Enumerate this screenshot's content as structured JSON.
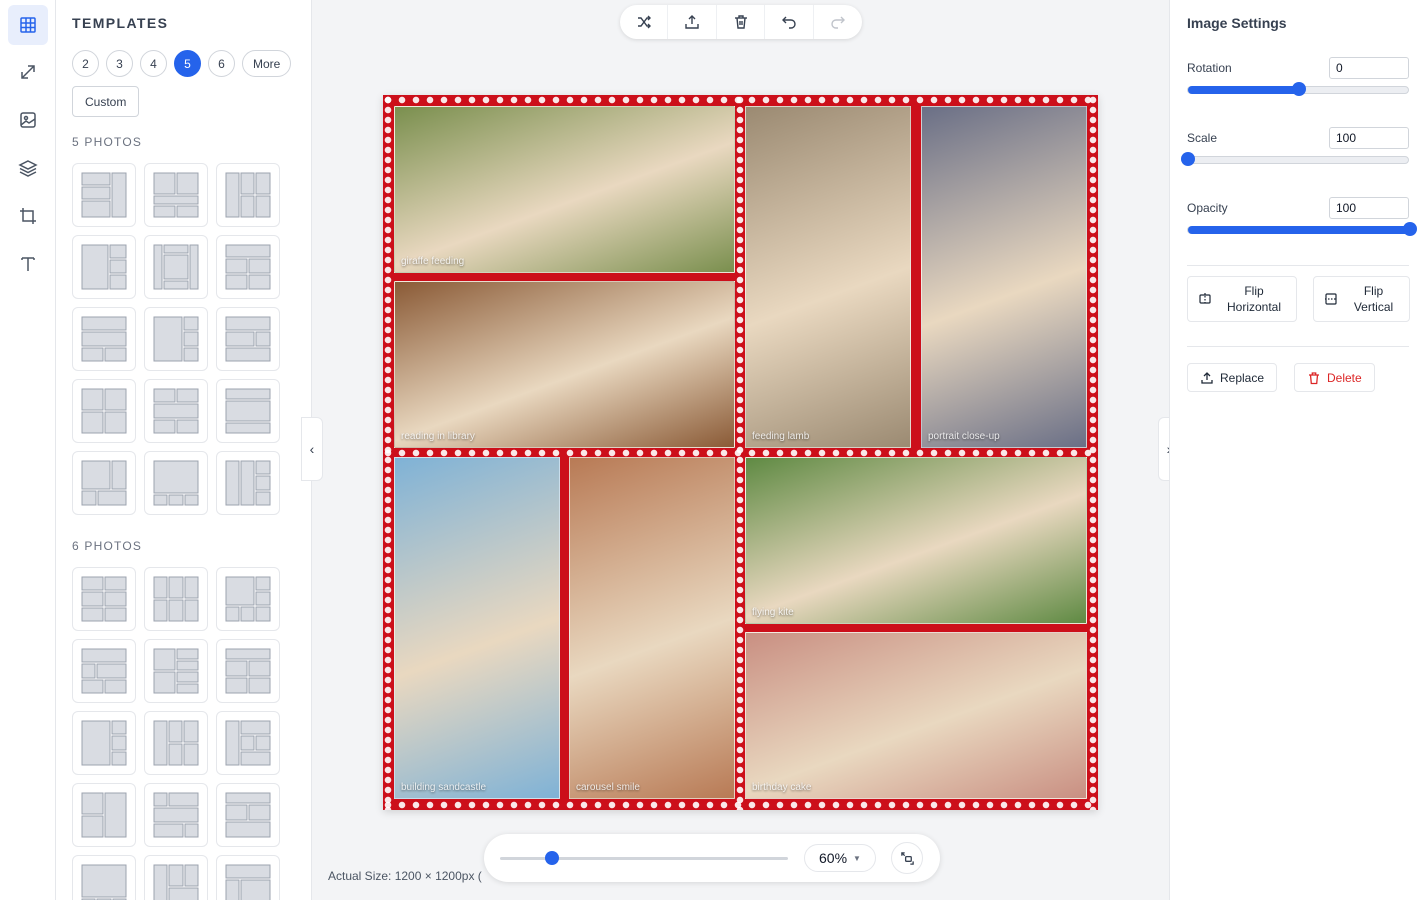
{
  "rail": {
    "items": [
      {
        "icon": "layout-grid-icon",
        "active": true
      },
      {
        "icon": "resize-icon",
        "active": false
      },
      {
        "icon": "image-edit-icon",
        "active": false
      },
      {
        "icon": "layers-icon",
        "active": false
      },
      {
        "icon": "crop-icon",
        "active": false
      },
      {
        "icon": "text-icon",
        "active": false
      }
    ]
  },
  "templates": {
    "title": "TEMPLATES",
    "counts": [
      "2",
      "3",
      "4",
      "5",
      "6",
      "More"
    ],
    "active_count": "5",
    "custom_label": "Custom",
    "section_5": "5 PHOTOS",
    "section_6": "6 PHOTOS"
  },
  "toolbar": {
    "buttons": [
      "shuffle-icon",
      "export-icon",
      "trash-icon",
      "undo-icon",
      "redo-icon"
    ]
  },
  "canvas": {
    "background": "#cc0f1a",
    "photos": [
      {
        "caption": "giraffe feeding",
        "color": "#7a8f4e"
      },
      {
        "caption": "reading in library",
        "color": "#8a5a36"
      },
      {
        "caption": "feeding lamb",
        "color": "#9b8a72"
      },
      {
        "caption": "portrait close-up",
        "color": "#6a6f86"
      },
      {
        "caption": "building sandcastle",
        "color": "#7fb2d6"
      },
      {
        "caption": "carousel smile",
        "color": "#b87a55"
      },
      {
        "caption": "flying kite",
        "color": "#5f8a43"
      },
      {
        "caption": "birthday cake",
        "color": "#c98f82"
      }
    ]
  },
  "zoom": {
    "value": "60%",
    "level": 0.18,
    "actual_size": "Actual Size: 1200 × 1200px ("
  },
  "settings": {
    "title": "Image Settings",
    "rotation_label": "Rotation",
    "rotation_value": "0",
    "rotation_level": 0.5,
    "scale_label": "Scale",
    "scale_value": "100",
    "scale_level": 0.0,
    "opacity_label": "Opacity",
    "opacity_value": "100",
    "opacity_level": 1.0,
    "flip_h_line1": "Flip",
    "flip_h_line2": "Horizontal",
    "flip_v_line1": "Flip",
    "flip_v_line2": "Vertical",
    "replace_label": "Replace",
    "delete_label": "Delete",
    "accent": "#2563eb",
    "danger": "#dc2626"
  }
}
